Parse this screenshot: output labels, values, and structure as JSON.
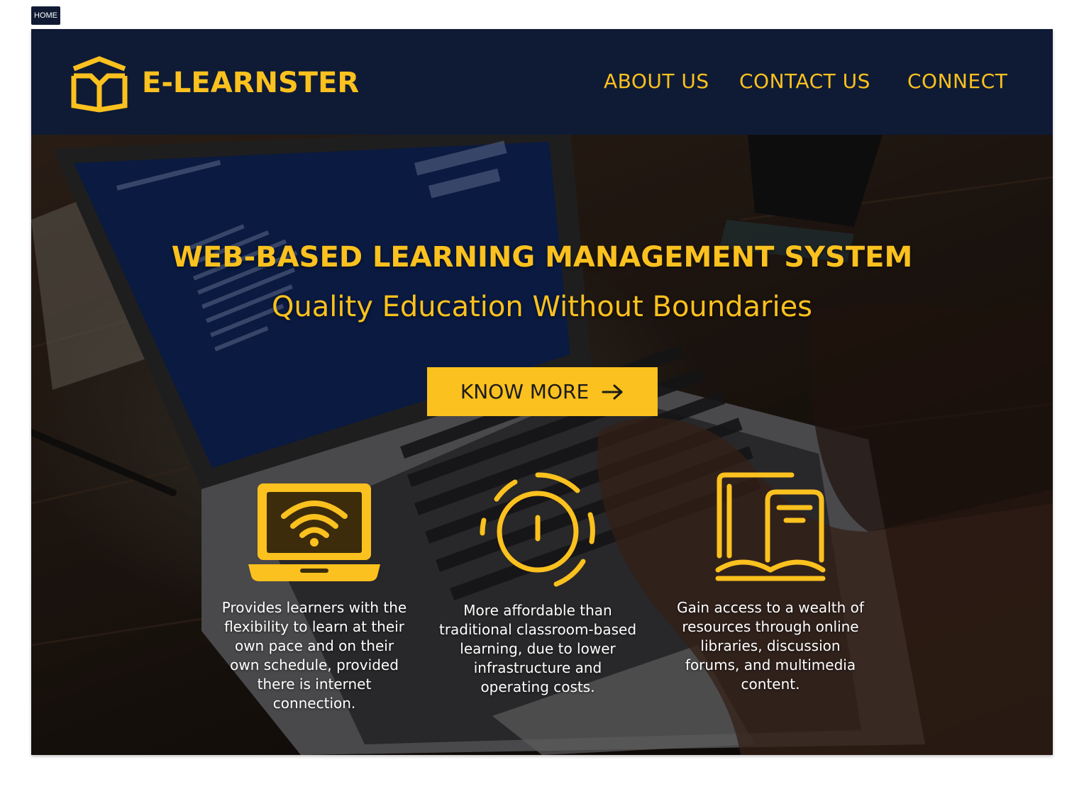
{
  "home_tag": "HOME",
  "header": {
    "brand": "E-LEARNSTER",
    "nav": [
      "ABOUT US",
      "CONTACT US",
      "CONNECT"
    ]
  },
  "hero": {
    "title": "WEB-BASED LEARNING MANAGEMENT SYSTEM",
    "subtitle": "Quality Education Without Boundaries",
    "cta_label": "KNOW MORE",
    "features": [
      {
        "icon": "laptop-wifi-icon",
        "text": "Provides learners with the flexibility to learn at their own pace and on their own schedule, provided there is internet connection."
      },
      {
        "icon": "timer-icon",
        "text": "More affordable than traditional classroom-based learning, due to lower infrastructure and operating costs."
      },
      {
        "icon": "library-book-icon",
        "text": "Gain access to a wealth of resources through online libraries, discussion forums, and multimedia content."
      }
    ]
  },
  "colors": {
    "navy": "#0f1b35",
    "accent": "#fbc11e",
    "white": "#ffffff"
  }
}
